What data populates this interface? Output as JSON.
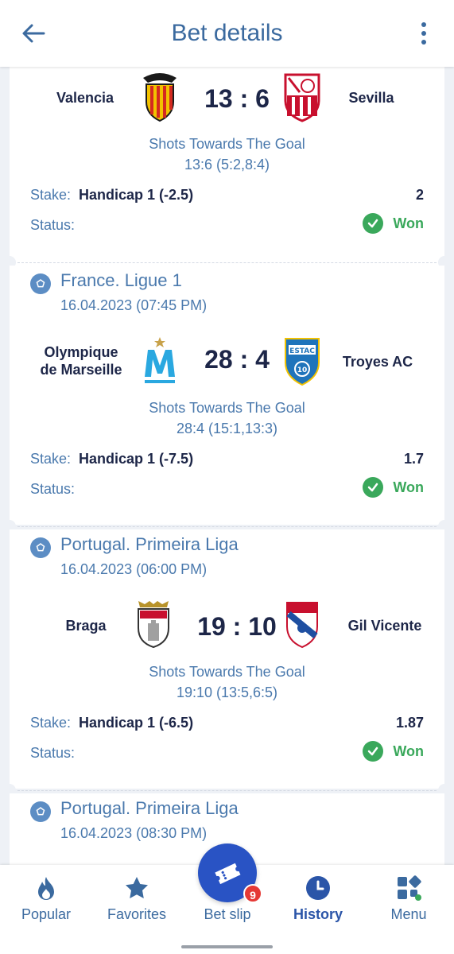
{
  "header": {
    "title": "Bet details"
  },
  "labels": {
    "stake": "Stake:",
    "status": "Status:",
    "market": "Shots Towards The Goal"
  },
  "bets": [
    {
      "home_team": "Valencia",
      "away_team": "Sevilla",
      "score": "13 : 6",
      "market_detail": "13:6 (5:2,8:4)",
      "stake": "Handicap 1 (-2.5)",
      "odds": "2",
      "status": "Won"
    },
    {
      "league": "France. Ligue 1",
      "date": "16.04.2023 (07:45 PM)",
      "home_team_line1": "Olympique",
      "home_team_line2": "de Marseille",
      "away_team": "Troyes AC",
      "score": "28 : 4",
      "market_detail": "28:4 (15:1,13:3)",
      "stake": "Handicap 1 (-7.5)",
      "odds": "1.7",
      "status": "Won"
    },
    {
      "league": "Portugal. Primeira Liga",
      "date": "16.04.2023 (06:00 PM)",
      "home_team": "Braga",
      "away_team": "Gil Vicente",
      "score": "19 : 10",
      "market_detail": "19:10 (13:5,6:5)",
      "stake": "Handicap 1 (-6.5)",
      "odds": "1.87",
      "status": "Won"
    },
    {
      "league": "Portugal. Primeira Liga",
      "date": "16.04.2023 (08:30 PM)"
    }
  ],
  "bottom_nav": {
    "popular": "Popular",
    "favorites": "Favorites",
    "bet_slip": "Bet slip",
    "bet_slip_count": "9",
    "history": "History",
    "menu": "Menu"
  },
  "colors": {
    "accent": "#2953c4",
    "won": "#3aa85b",
    "link": "#4a79ad",
    "badge": "#e53935"
  }
}
